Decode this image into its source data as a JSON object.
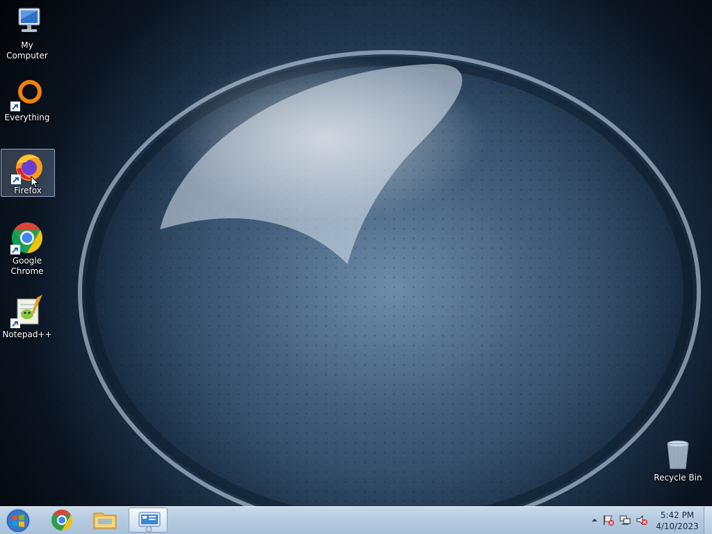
{
  "desktop": {
    "icons": [
      {
        "label": "My Computer",
        "icon": "my-computer-icon"
      },
      {
        "label": "Everything",
        "icon": "everything-icon"
      },
      {
        "label": "Firefox",
        "icon": "firefox-icon"
      },
      {
        "label": "Google Chrome",
        "icon": "chrome-icon"
      },
      {
        "label": "Notepad++",
        "icon": "notepad-plus-plus-icon"
      },
      {
        "label": "Recycle Bin",
        "icon": "recycle-bin-icon"
      }
    ],
    "selected_icon": "Firefox"
  },
  "taskbar": {
    "start_icon": "windows-start-icon",
    "pinned": [
      {
        "name": "Google Chrome",
        "icon": "chrome-icon"
      },
      {
        "name": "Windows Explorer",
        "icon": "folder-icon"
      },
      {
        "name": "Control Panel",
        "icon": "control-panel-icon",
        "active": true
      }
    ],
    "tray": {
      "icons": [
        "show-hidden-icons-arrow",
        "action-center-flag-icon",
        "network-icon",
        "volume-muted-icon"
      ],
      "time": "5:42 PM",
      "date": "4/10/2023"
    }
  },
  "colors": {
    "taskbar": "#b6cbe0",
    "wallpaper_dark": "#020407",
    "wallpaper_mid": "#3d5a77"
  }
}
